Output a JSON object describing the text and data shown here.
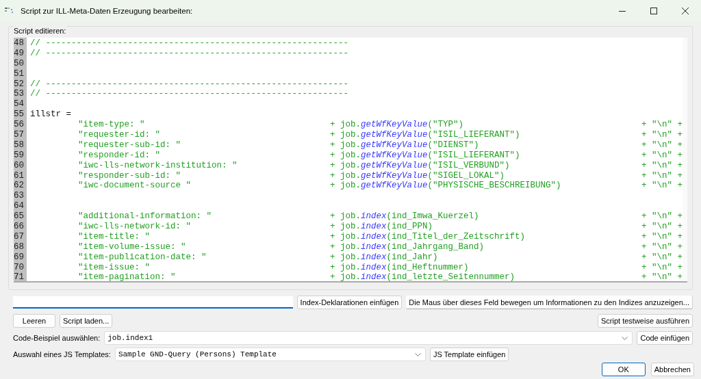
{
  "window": {
    "title": "Script zur ILL-Meta-Daten Erzeugung bearbeiten:"
  },
  "group": {
    "label": "Script editieren:"
  },
  "editor": {
    "lines": [
      {
        "num": "48",
        "kind": "comment",
        "text": "// -----------------------------------------------------------"
      },
      {
        "num": "49",
        "kind": "comment",
        "text": "// -----------------------------------------------------------"
      },
      {
        "num": "50",
        "kind": "blank"
      },
      {
        "num": "51",
        "kind": "blank"
      },
      {
        "num": "52",
        "kind": "comment",
        "text": "// -----------------------------------------------------------"
      },
      {
        "num": "53",
        "kind": "comment",
        "text": "// -----------------------------------------------------------"
      },
      {
        "num": "54",
        "kind": "blank"
      },
      {
        "num": "55",
        "kind": "plain",
        "text": "illstr ="
      },
      {
        "num": "56",
        "kind": "entry",
        "key": "\"item-type: \"",
        "obj": "+ job.",
        "method": "getWfKeyValue",
        "args": "(\"TYP\")",
        "tail": "+ \"\\n\" +"
      },
      {
        "num": "57",
        "kind": "entry",
        "key": "\"requester-id: \"",
        "obj": "+ job.",
        "method": "getWfKeyValue",
        "args": "(\"ISIL_LIEFERANT\")",
        "tail": "+ \"\\n\" +"
      },
      {
        "num": "58",
        "kind": "entry",
        "key": "\"requester-sub-id: \"",
        "obj": "+ job.",
        "method": "getWfKeyValue",
        "args": "(\"DIENST\")",
        "tail": "+ \"\\n\" +"
      },
      {
        "num": "59",
        "kind": "entry",
        "key": "\"responder-id: \"",
        "obj": "+ job.",
        "method": "getWfKeyValue",
        "args": "(\"ISIL_LIEFERANT\")",
        "tail": "+ \"\\n\" +"
      },
      {
        "num": "60",
        "kind": "entry",
        "key": "\"iwc-lls-network-institution: \"",
        "obj": "+ job.",
        "method": "getWfKeyValue",
        "args": "(\"ISIL_VERBUND\")",
        "tail": "+ \"\\n\" +"
      },
      {
        "num": "61",
        "kind": "entry",
        "key": "\"responder-sub-id: \"",
        "obj": "+ job.",
        "method": "getWfKeyValue",
        "args": "(\"SIGEL_LOKAL\")",
        "tail": "+ \"\\n\" +"
      },
      {
        "num": "62",
        "kind": "entry",
        "key": "\"iwc-document-source \"",
        "obj": "+ job.",
        "method": "getWfKeyValue",
        "args": "(\"PHYSISCHE_BESCHREIBUNG\")",
        "tail": "+ \"\\n\" +"
      },
      {
        "num": "63",
        "kind": "blank"
      },
      {
        "num": "64",
        "kind": "blank"
      },
      {
        "num": "65",
        "kind": "entry",
        "key": "\"additional-information: \"",
        "obj": "+ job.",
        "method": "index",
        "args": "(ind_Imwa_Kuerzel)",
        "tail": "+ \"\\n\" +"
      },
      {
        "num": "66",
        "kind": "entry",
        "key": "\"iwc-lls-network-id: \"",
        "obj": "+ job.",
        "method": "index",
        "args": "(ind_PPN)",
        "tail": "+ \"\\n\" +"
      },
      {
        "num": "67",
        "kind": "entry",
        "key": "\"item-title: \"",
        "obj": "+ job.",
        "method": "index",
        "args": "(ind_Titel_der_Zeitschrift)",
        "tail": "+ \"\\n\" +"
      },
      {
        "num": "68",
        "kind": "entry",
        "key": "\"item-volume-issue: \"",
        "obj": "+ job.",
        "method": "index",
        "args": "(ind_Jahrgang_Band)",
        "tail": "+ \"\\n\" +"
      },
      {
        "num": "69",
        "kind": "entry",
        "key": "\"item-publication-date: \"",
        "obj": "+ job.",
        "method": "index",
        "args": "(ind_Jahr)",
        "tail": "+ \"\\n\" +"
      },
      {
        "num": "70",
        "kind": "entry",
        "key": "\"item-issue: \"",
        "obj": "+ job.",
        "method": "index",
        "args": "(ind_Heftnummer)",
        "tail": "+ \"\\n\" +"
      },
      {
        "num": "71",
        "kind": "entry",
        "key": "\"item-pagination: \"",
        "obj": "+ job.",
        "method": "index",
        "args": "(ind_letzte_Seitennummer)",
        "tail": "+ \"\\n\" +"
      }
    ]
  },
  "index_row": {
    "insert_button": "Index-Deklarationen einfügen",
    "info_button": "Die Maus über dieses Feld bewegen um Informationen zu den Indizes anzuzeigen..."
  },
  "buttons_row": {
    "clear": "Leeren",
    "load": "Script laden...",
    "test": "Script testweise ausführen"
  },
  "code_example": {
    "label": "Code-Beispiel auswählen:",
    "value": "job.index1",
    "button": "Code einfügen"
  },
  "template": {
    "label": "Auswahl eines JS Templates:",
    "value": "Sample GND-Query (Persons) Template",
    "button": "JS Template einfügen"
  },
  "footer": {
    "ok": "OK",
    "cancel": "Abbrechen"
  }
}
